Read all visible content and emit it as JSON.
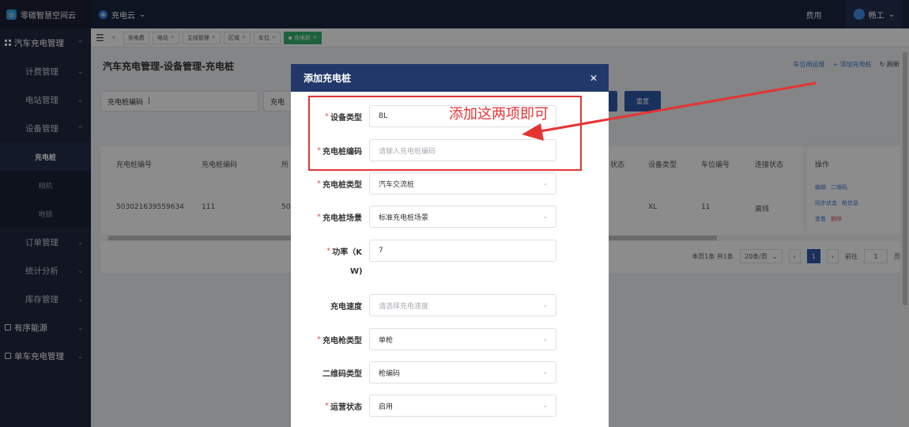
{
  "topbar": {
    "brand": "零碳智慧空间云",
    "app_name": "充电云",
    "fee_label": "费用",
    "user_name": "畅工"
  },
  "sidebar": {
    "group1": "汽车充电管理",
    "items": [
      "计费管理",
      "电站管理",
      "设备管理"
    ],
    "sub_items": [
      "充电桩",
      "相机",
      "地锁"
    ],
    "items2": [
      "订单管理",
      "统计分析",
      "库存管理"
    ],
    "group2": "有序能源",
    "group3": "单车充电管理"
  },
  "tabs": [
    "充电费",
    "电站",
    "主线管理",
    "区域",
    "车位",
    "充电桩"
  ],
  "page": {
    "title": "汽车充电管理-设备管理-充电桩",
    "link_parking": "车位闸运维",
    "link_add": "+ 添加充电桩",
    "link_refresh": "刷新",
    "search_label1": "充电桩编码",
    "search_label2": "充电",
    "reset_label": "重置"
  },
  "table": {
    "headers": [
      "充电桩编号",
      "充电桩编码",
      "所",
      "状态",
      "设备类型",
      "车位编号",
      "连接状态",
      "操作"
    ],
    "row": [
      "503021639559634",
      "111",
      "50",
      "XL",
      "11",
      "离线"
    ],
    "ops": [
      "编辑",
      "二维码",
      "同步状态",
      "枪信息",
      "查看",
      "删除"
    ]
  },
  "pager": {
    "summary": "本页1条  共1条",
    "page_size": "20条/页",
    "current": "1",
    "goto_label": "前往",
    "goto_value": "1",
    "page_suffix": "页"
  },
  "modal": {
    "title": "添加充电桩",
    "fields": [
      {
        "label": "设备类型",
        "value": "BL",
        "required": true
      },
      {
        "label": "充电桩编码",
        "value": "请输入充电桩编码",
        "required": true
      },
      {
        "label": "充电桩类型",
        "value": "汽车交流桩",
        "required": true
      },
      {
        "label": "充电桩场景",
        "value": "标准充电桩场景",
        "required": true
      },
      {
        "label": "功率（K",
        "label2": "W)",
        "value": "7",
        "required": true
      },
      {
        "label": "充电速度",
        "value": "请选择充电速度",
        "required": false
      },
      {
        "label": "充电枪类型",
        "value": "单枪",
        "required": true
      },
      {
        "label": "二维码类型",
        "value": "枪编码",
        "required": false
      },
      {
        "label": "运营状态",
        "value": "启用",
        "required": true
      }
    ]
  },
  "annotation": {
    "text": "添加这两项即可",
    "color": "#e53434"
  }
}
